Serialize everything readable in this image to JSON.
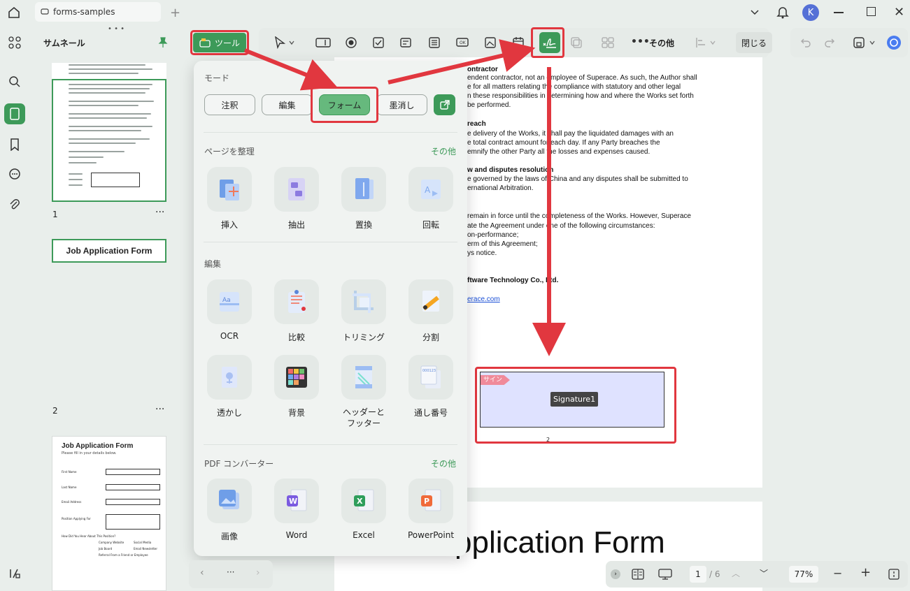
{
  "titlebar": {
    "tab_title": "forms-samples",
    "avatar_letter": "K"
  },
  "thumbnails": {
    "title": "サムネール",
    "pages": [
      {
        "num": "1"
      },
      {
        "num": "2"
      }
    ],
    "page2_title": "Job Application Form",
    "page3_title": "Job Application Form",
    "page3_sub": "Please fill in your details below.",
    "page3_fields": [
      "First Name",
      "Last Name",
      "Email Address",
      "Position Applying For"
    ],
    "page3_question": "How Did You Hear About This Position?",
    "page3_options": [
      "Company Website",
      "Job Board",
      "Referral From a Friend or Employee",
      "Social Media",
      "Email Newsletter"
    ]
  },
  "toolbar": {
    "tools_label": "ツール",
    "more_label": "その他",
    "close_label": "閉じる"
  },
  "popup": {
    "mode_title": "モード",
    "modes": [
      "注釈",
      "編集",
      "フォーム",
      "墨消し"
    ],
    "organize_title": "ページを整理",
    "organize_more": "その他",
    "organize_items": [
      "挿入",
      "抽出",
      "置換",
      "回転"
    ],
    "edit_title": "編集",
    "edit_items": [
      "OCR",
      "比較",
      "トリミング",
      "分割",
      "透かし",
      "背景",
      "ヘッダーと\nフッター",
      "通し番号"
    ],
    "convert_title": "PDF コンバーター",
    "convert_more": "その他",
    "convert_items": [
      "画像",
      "Word",
      "Excel",
      "PowerPoint"
    ]
  },
  "document": {
    "lines": [
      {
        "text": "ontractor",
        "bold": true
      },
      {
        "text": "endent contractor, not an employee of Superace. As such, the Author shall"
      },
      {
        "text": "e for all matters relating the compliance with statutory and other legal"
      },
      {
        "text": "n these responsibilities in determining how and where the Works set forth"
      },
      {
        "text": "be performed."
      },
      {
        "text": "reach",
        "bold": true
      },
      {
        "text": "e delivery of the Works, it shall pay the liquidated damages with an"
      },
      {
        "text": "e total contract amount for each day. If any Party breaches the"
      },
      {
        "text": "emnify the other Party all the losses and expenses caused."
      },
      {
        "text": "w and disputes resolution",
        "bold": true
      },
      {
        "text": "e governed by the laws of China and any disputes shall be submitted to"
      },
      {
        "text": "ernational Arbitration."
      },
      {
        "text": "remain in force until the completeness of the Works. However, Superace"
      },
      {
        "text": "ate the Agreement under one of the following circumstances:"
      },
      {
        "text": "on-performance;"
      },
      {
        "text": "erm of this Agreement;"
      },
      {
        "text": "ys notice."
      },
      {
        "text": "ftware Technology Co., Ltd.",
        "bold": true
      },
      {
        "text": "erace.com",
        "link": true
      }
    ],
    "sign_tag": "サイン",
    "signature_field": "Signature1",
    "page_marker": "2",
    "page2_title": "pplication Form"
  },
  "bottombar": {
    "page_current": "1",
    "page_total": "/ 6",
    "zoom": "77%"
  },
  "colors": {
    "accent": "#3d9a59",
    "highlight": "#e1373f",
    "signature_fill": "#dfe2ff"
  }
}
